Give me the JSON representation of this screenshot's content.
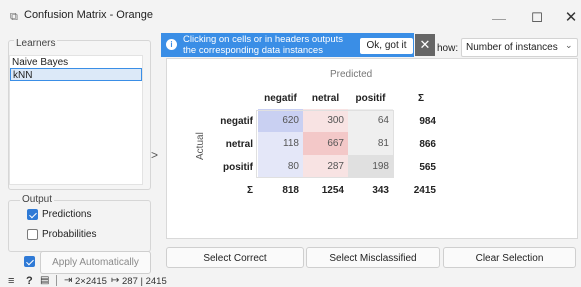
{
  "window": {
    "title": "Confusion Matrix - Orange",
    "app_icon": "orange-widget-icon",
    "minimize_glyph": "—",
    "maximize_glyph": "☐",
    "close_glyph": "✕"
  },
  "learners": {
    "title": "Learners",
    "items": [
      {
        "label": "Naive Bayes",
        "selected": false
      },
      {
        "label": "kNN",
        "selected": true
      }
    ]
  },
  "output": {
    "title": "Output",
    "predictions": {
      "label": "Predictions",
      "checked": true
    },
    "probabilities": {
      "label": "Probabilities",
      "checked": false
    }
  },
  "apply": {
    "label": "Apply Automatically",
    "checked": true
  },
  "notification": {
    "icon": "info-icon",
    "text": "Clicking on cells or in headers outputs the corresponding data instances",
    "ok_label": "Ok, got it",
    "close_glyph": "✕"
  },
  "show": {
    "label": "how:",
    "value": "Number of instances"
  },
  "matrix": {
    "predicted_label": "Predicted",
    "actual_label": "Actual",
    "columns": [
      "negatif",
      "netral",
      "positif"
    ],
    "sum_symbol": "Σ",
    "rows": [
      {
        "label": "negatif",
        "values": [
          "620",
          "300",
          "64"
        ],
        "sum": "984"
      },
      {
        "label": "netral",
        "values": [
          "118",
          "667",
          "81"
        ],
        "sum": "866"
      },
      {
        "label": "positif",
        "values": [
          "80",
          "287",
          "198"
        ],
        "sum": "565"
      }
    ],
    "column_sums": [
      "818",
      "1254",
      "343"
    ],
    "total": "2415",
    "colors": {
      "negatif_col": "#c9d0f2",
      "netral_col": "#f3c8c8",
      "positif_col": "#e0e0e0",
      "light_blue": "#e4e7f8",
      "light_pink": "#f8e3e3",
      "light_grey": "#efefef"
    }
  },
  "buttons": {
    "select_correct": "Select Correct",
    "select_misclassified": "Select Misclassified",
    "clear_selection": "Clear Selection"
  },
  "statusbar": {
    "input_summary": "2×2415",
    "output_summary": "287 | 2415"
  },
  "accent_color": "#3a8ee6"
}
